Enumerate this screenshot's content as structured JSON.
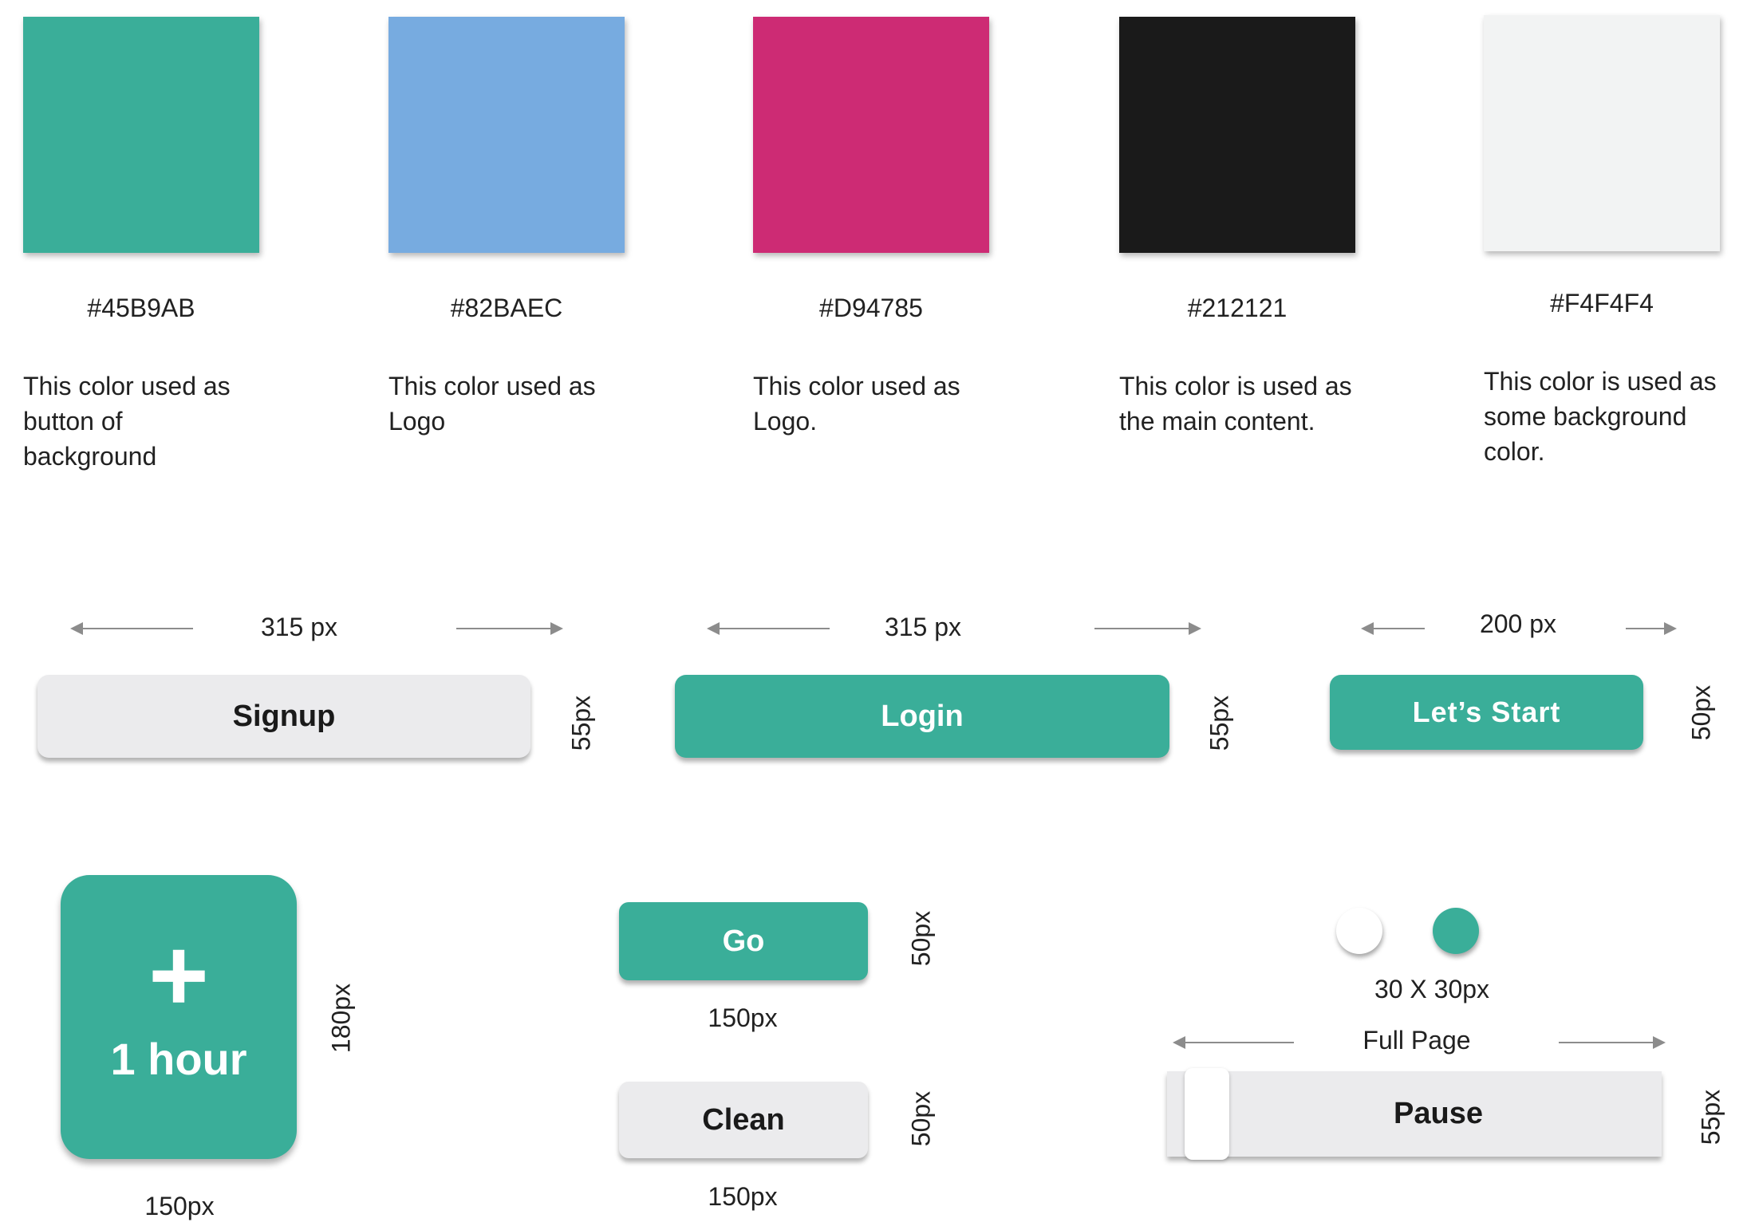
{
  "swatches": [
    {
      "color": "#3aae99",
      "hex": "#45B9AB",
      "description": "This color  used as\nbutton of\nbackground"
    },
    {
      "color": "#77abe0",
      "hex": "#82BAEC",
      "description": "This color used as\nLogo"
    },
    {
      "color": "#cd2b74",
      "hex": "#D94785",
      "description": "This color used as\nLogo."
    },
    {
      "color": "#1a1a1a",
      "hex": "#212121",
      "description": "This color is used as\nthe main content."
    },
    {
      "color": "#f2f3f3",
      "hex": "#F4F4F4",
      "description": "This color is used as\nsome background\ncolor."
    }
  ],
  "buttons_row": {
    "signup": {
      "label": "Signup",
      "width_label": "315 px",
      "height_label": "55px"
    },
    "login": {
      "label": "Login",
      "width_label": "315 px",
      "height_label": "55px"
    },
    "lets_start": {
      "label": "Let’s Start",
      "width_label": "200 px",
      "height_label": "50px"
    }
  },
  "tile": {
    "icon": "plus-icon",
    "label": "1 hour",
    "width_label": "150px",
    "height_label": "180px"
  },
  "go": {
    "label": "Go",
    "width_label": "150px",
    "height_label": "50px"
  },
  "clean": {
    "label": "Clean",
    "width_label": "150px",
    "height_label": "50px"
  },
  "toggles": {
    "size_label": "30 X 30px",
    "off_color": "#ffffff",
    "on_color": "#3aae99"
  },
  "pause": {
    "label": "Pause",
    "width_label": "Full Page",
    "height_label": "55px"
  }
}
